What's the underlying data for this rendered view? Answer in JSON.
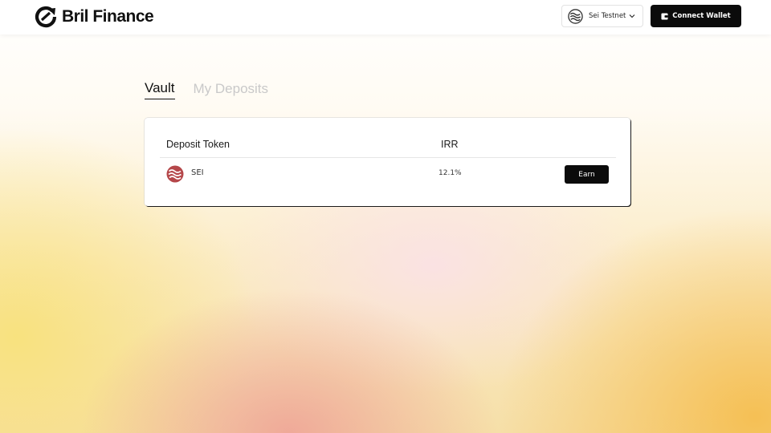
{
  "header": {
    "brand_name": "Bril Finance",
    "network_label": "Sei Testnet",
    "connect_label": "Connect Wallet"
  },
  "tabs": [
    {
      "label": "Vault",
      "active": true
    },
    {
      "label": "My Deposits",
      "active": false
    }
  ],
  "table": {
    "columns": [
      "Deposit Token",
      "IRR"
    ],
    "rows": [
      {
        "token": "SEI",
        "token_icon": "sei-logo-icon",
        "irr": "12.1%",
        "action_label": "Earn"
      }
    ]
  },
  "colors": {
    "primary_button": "#0b0b0b",
    "sei_token": "#b5474a",
    "inactive_tab": "#c9c9c9"
  }
}
